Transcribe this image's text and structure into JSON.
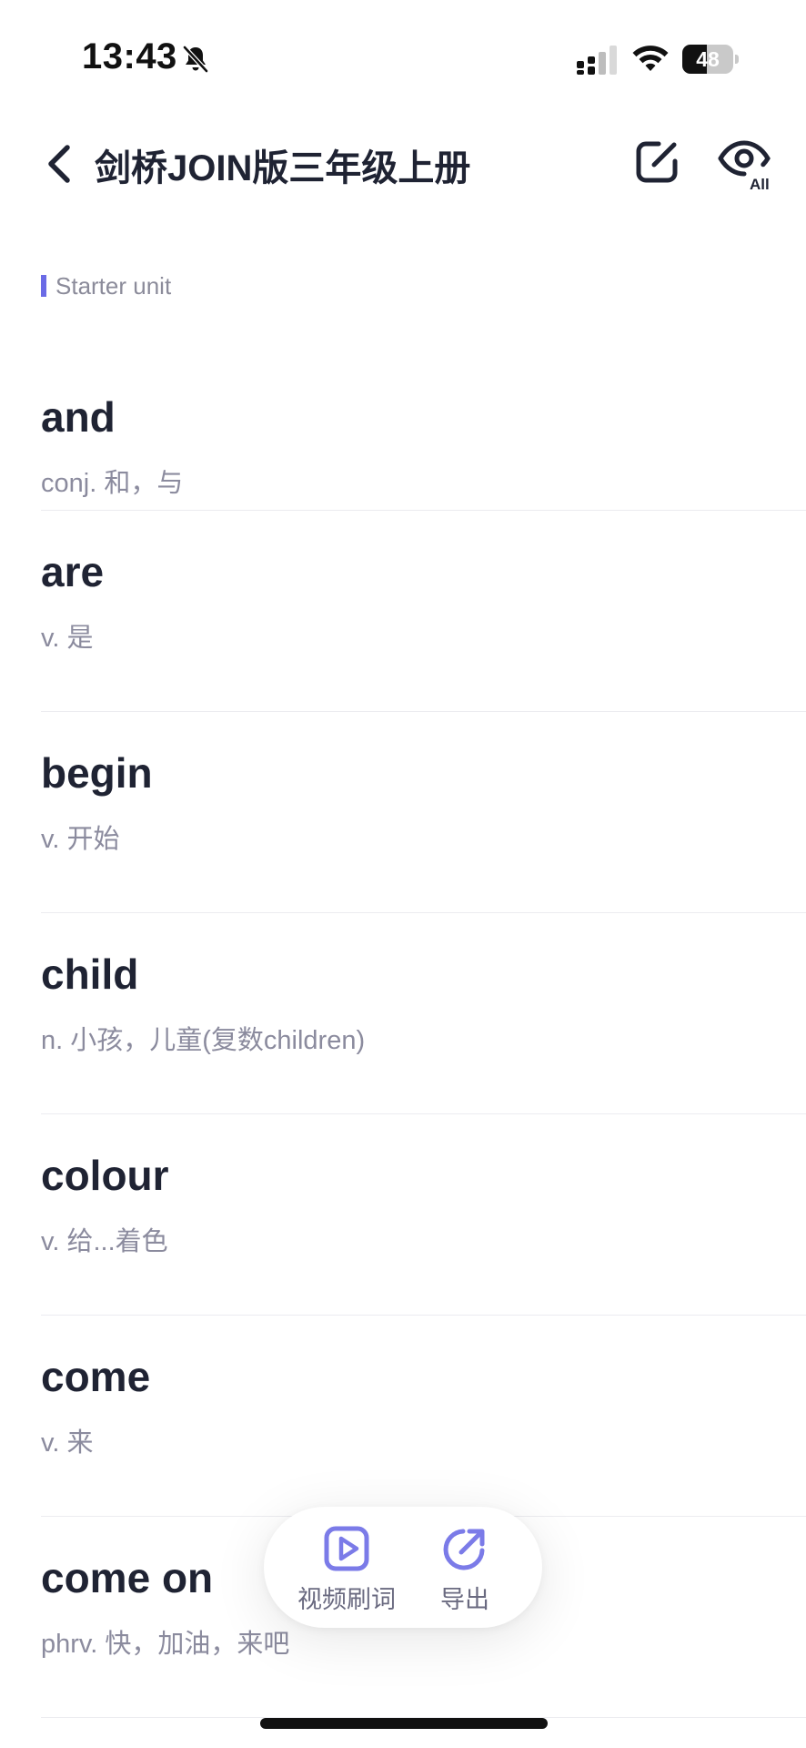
{
  "status_bar": {
    "time": "13:43",
    "battery_level": "48",
    "battery_fraction": 0.48
  },
  "nav": {
    "title": "剑桥JOIN版三年级上册"
  },
  "icons": {
    "back": "chevron-left-icon",
    "edit": "edit-square-icon",
    "eye_all": "eye-all-icon",
    "video": "video-play-icon",
    "export": "share-out-icon"
  },
  "colors": {
    "accent": "#6b6be6",
    "word": "#1f2333",
    "definition": "#8b8b9e"
  },
  "section": {
    "label": "Starter unit"
  },
  "words": [
    {
      "term": "and",
      "definition": "conj. 和，与"
    },
    {
      "term": "are",
      "definition": "v. 是"
    },
    {
      "term": "begin",
      "definition": "v. 开始"
    },
    {
      "term": "child",
      "definition": "n. 小孩，儿童(复数children)"
    },
    {
      "term": "colour",
      "definition": "v. 给...着色"
    },
    {
      "term": "come",
      "definition": "v. 来"
    },
    {
      "term": "come on",
      "definition": "phrv. 快，加油，来吧"
    }
  ],
  "actions": {
    "video_label": "视频刷词",
    "export_label": "导出"
  }
}
